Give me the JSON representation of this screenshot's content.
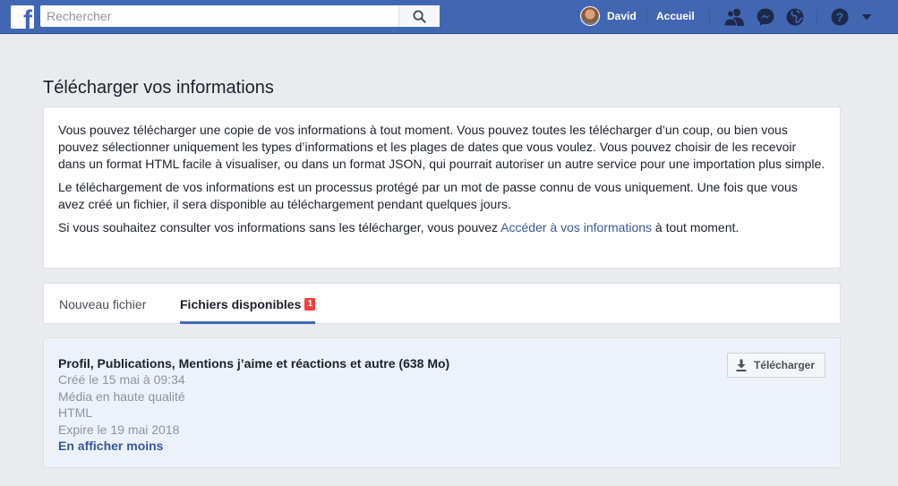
{
  "topbar": {
    "logo_letter": "f",
    "search_placeholder": "Rechercher",
    "user_name": "David",
    "home_label": "Accueil"
  },
  "page": {
    "title": "Télécharger vos informations"
  },
  "intro": {
    "p1": "Vous pouvez télécharger une copie de vos informations à tout moment. Vous pouvez toutes les télécharger d’un coup, ou bien vous pouvez sélectionner uniquement les types d’informations et les plages de dates que vous voulez. Vous pouvez choisir de les recevoir dans un format HTML facile à visualiser, ou dans un format JSON, qui pourrait autoriser un autre service pour une importation plus simple.",
    "p2": "Le téléchargement de vos informations est un processus protégé par un mot de passe connu de vous uniquement. Une fois que vous avez créé un fichier, il sera disponible au téléchargement pendant quelques jours.",
    "p3_before": "Si vous souhaitez consulter vos informations sans les télécharger, vous pouvez ",
    "p3_link": "Accéder à vos informations",
    "p3_after": " à tout moment."
  },
  "tabs": [
    {
      "label": "Nouveau fichier",
      "active": false
    },
    {
      "label": "Fichiers disponibles",
      "active": true,
      "badge": "1"
    }
  ],
  "file": {
    "title": "Profil, Publications, Mentions j’aime et réactions et autre (638 Mo)",
    "created": "Créé le 15 mai à 09:34",
    "quality": "Média en haute qualité",
    "format": "HTML",
    "expires": "Expire le 19 mai 2018",
    "show_less": "En afficher moins",
    "download_label": "Télécharger"
  },
  "colors": {
    "brand": "#4267b2",
    "link": "#365899",
    "badge": "#fa3e3e"
  }
}
